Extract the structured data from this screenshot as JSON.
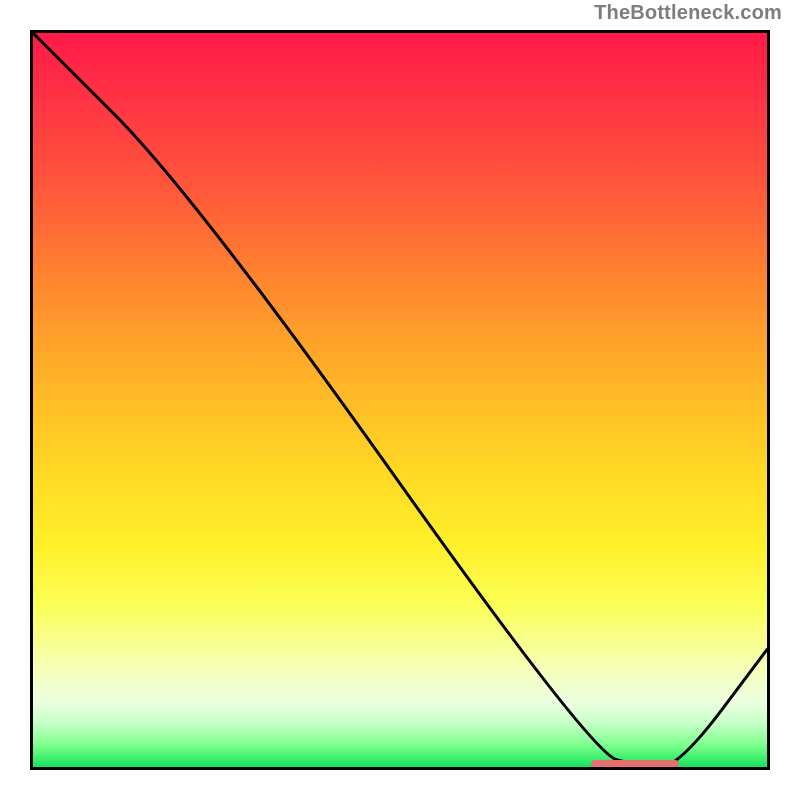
{
  "watermark": "TheBottleneck.com",
  "chart_data": {
    "type": "line",
    "title": "",
    "xlabel": "",
    "ylabel": "",
    "xlim": [
      0,
      100
    ],
    "ylim": [
      0,
      100
    ],
    "series": [
      {
        "name": "curve",
        "x": [
          0,
          22,
          76,
          83,
          88,
          100
        ],
        "values": [
          100,
          78,
          2,
          0,
          0,
          16
        ]
      }
    ],
    "optimal_band": {
      "x_start": 76,
      "x_end": 88,
      "y": 0
    },
    "colors": {
      "curve": "#000000",
      "marker": "#e76f6f",
      "gradient_top": "#ff1948",
      "gradient_bottom": "#16e45a"
    }
  }
}
